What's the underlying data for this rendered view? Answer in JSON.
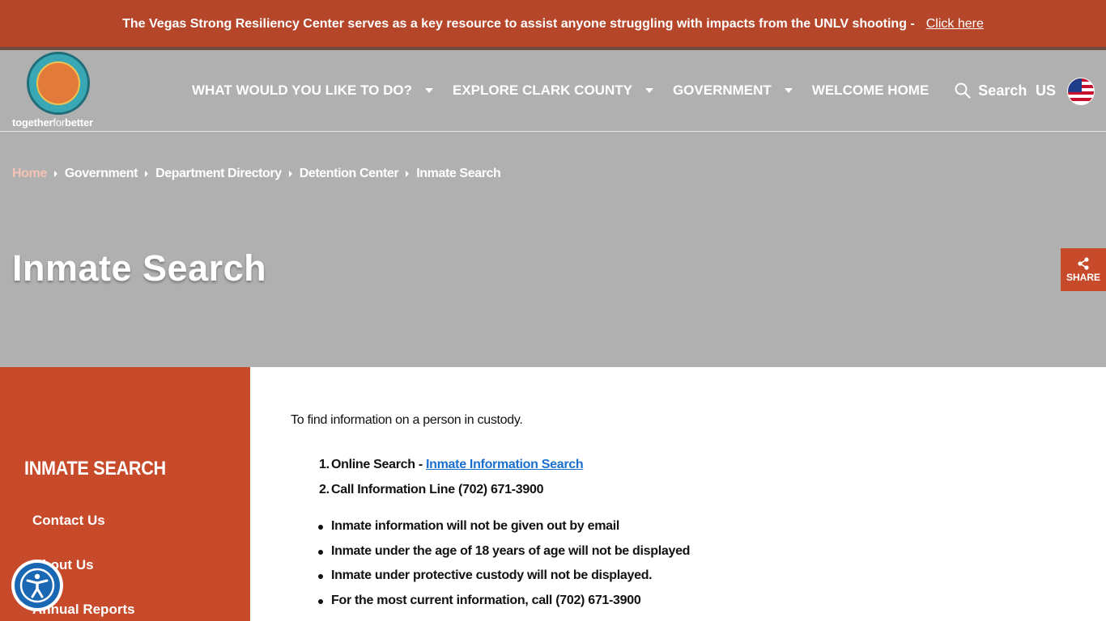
{
  "alert": {
    "text": "The Vegas Strong Resiliency Center serves as a key resource to assist anyone struggling with impacts from the UNLV shooting -",
    "link_label": "Click here"
  },
  "header": {
    "logo_tagline_a": "together",
    "logo_tagline_b": "for",
    "logo_tagline_c": "better",
    "nav": [
      {
        "label": "WHAT WOULD YOU LIKE TO DO?",
        "has_dropdown": true
      },
      {
        "label": "EXPLORE CLARK COUNTY",
        "has_dropdown": true
      },
      {
        "label": "GOVERNMENT",
        "has_dropdown": true
      },
      {
        "label": "WELCOME HOME",
        "has_dropdown": false
      }
    ],
    "search_label": "Search",
    "search_icon": "search-icon",
    "language_code": "US",
    "flag_icon": "us-flag-icon"
  },
  "breadcrumb": {
    "items": [
      "Home",
      "Government",
      "Department Directory",
      "Detention Center",
      "Inmate Search"
    ]
  },
  "page": {
    "title": "Inmate Search"
  },
  "share": {
    "label": "SHARE",
    "icon": "share-icon"
  },
  "sidebar": {
    "title": "INMATE SEARCH",
    "links": [
      "Contact Us",
      "About Us",
      "Annual Reports"
    ]
  },
  "content": {
    "intro": "To find information on a person in custody.",
    "steps": [
      {
        "number": "1.",
        "text": "Online Search - ",
        "link": "Inmate Information Search"
      },
      {
        "number": "2.",
        "text": "Call  Information Line (702) 671-3900",
        "link": ""
      }
    ],
    "notes": [
      "Inmate information will not be given out by email",
      "Inmate under the age of 18 years of age will not be displayed",
      "Inmate under protective custody will not be displayed.",
      "For the most current information, call (702) 671-3900"
    ]
  },
  "accessibility": {
    "icon": "accessibility-icon"
  },
  "colors": {
    "brand_orange": "#c74b2a",
    "alert_bg": "#b5462a",
    "hero_gray": "#b0b0b0",
    "link_blue": "#1a6fcf",
    "a11y_blue": "#1a68b3"
  }
}
